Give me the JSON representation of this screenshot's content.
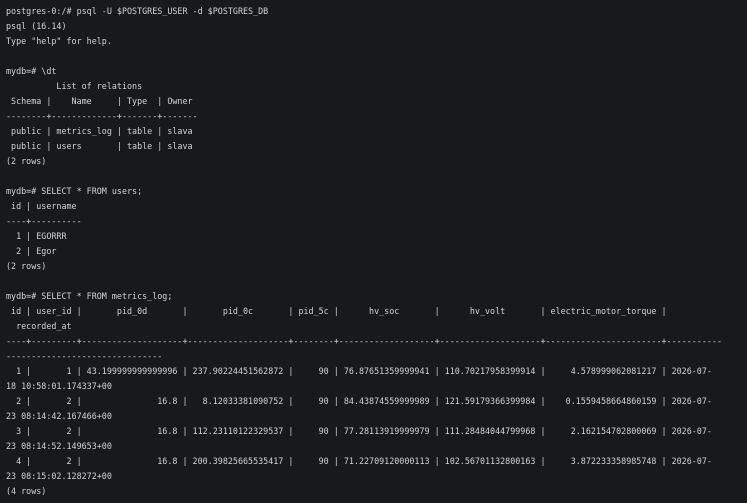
{
  "terminal": {
    "lines": [
      "postgres-0:/# psql -U $POSTGRES_USER -d $POSTGRES_DB",
      "psql (16.14)",
      "Type \"help\" for help.",
      "",
      "mydb=# \\dt",
      "          List of relations",
      " Schema |    Name     | Type  | Owner",
      "--------+-------------+-------+-------",
      " public | metrics_log | table | slava",
      " public | users       | table | slava",
      "(2 rows)",
      "",
      "mydb=# SELECT * FROM users;",
      " id | username",
      "----+----------",
      "  1 | EGORRR",
      "  2 | Egor",
      "(2 rows)",
      "",
      "mydb=# SELECT * FROM metrics_log;",
      " id | user_id |       pid_0d       |       pid_0c       | pid_5c |      hv_soc       |      hv_volt       | electric_motor_torque |",
      "  recorded_at",
      "----+---------+--------------------+--------------------+--------+-------------------+--------------------+-----------------------+-----------",
      "-------------------------------",
      "  1 |       1 | 43.199999999999996 | 237.90224451562872 |     90 | 76.87651359999941 | 110.70217958399914 |     4.578999062081217 | 2026-07-",
      "18 10:58:01.174337+00",
      "  2 |       2 |               16.8 |   8.12033381090752 |     90 | 84.43874559999989 | 121.59179366399984 |    0.1559458664860159 | 2026-07-",
      "23 08:14:42.167466+00",
      "  3 |       2 |               16.8 | 112.23110122329537 |     90 | 77.28113919999979 | 111.28484044799968 |     2.162154702800069 | 2026-07-",
      "23 08:14:52.149653+00",
      "  4 |       2 |               16.8 | 200.39825665535417 |     90 | 71.22709120000113 | 102.56701132800163 |     3.872233358985748 | 2026-07-",
      "23 08:15:02.128272+00",
      "(4 rows)"
    ]
  }
}
